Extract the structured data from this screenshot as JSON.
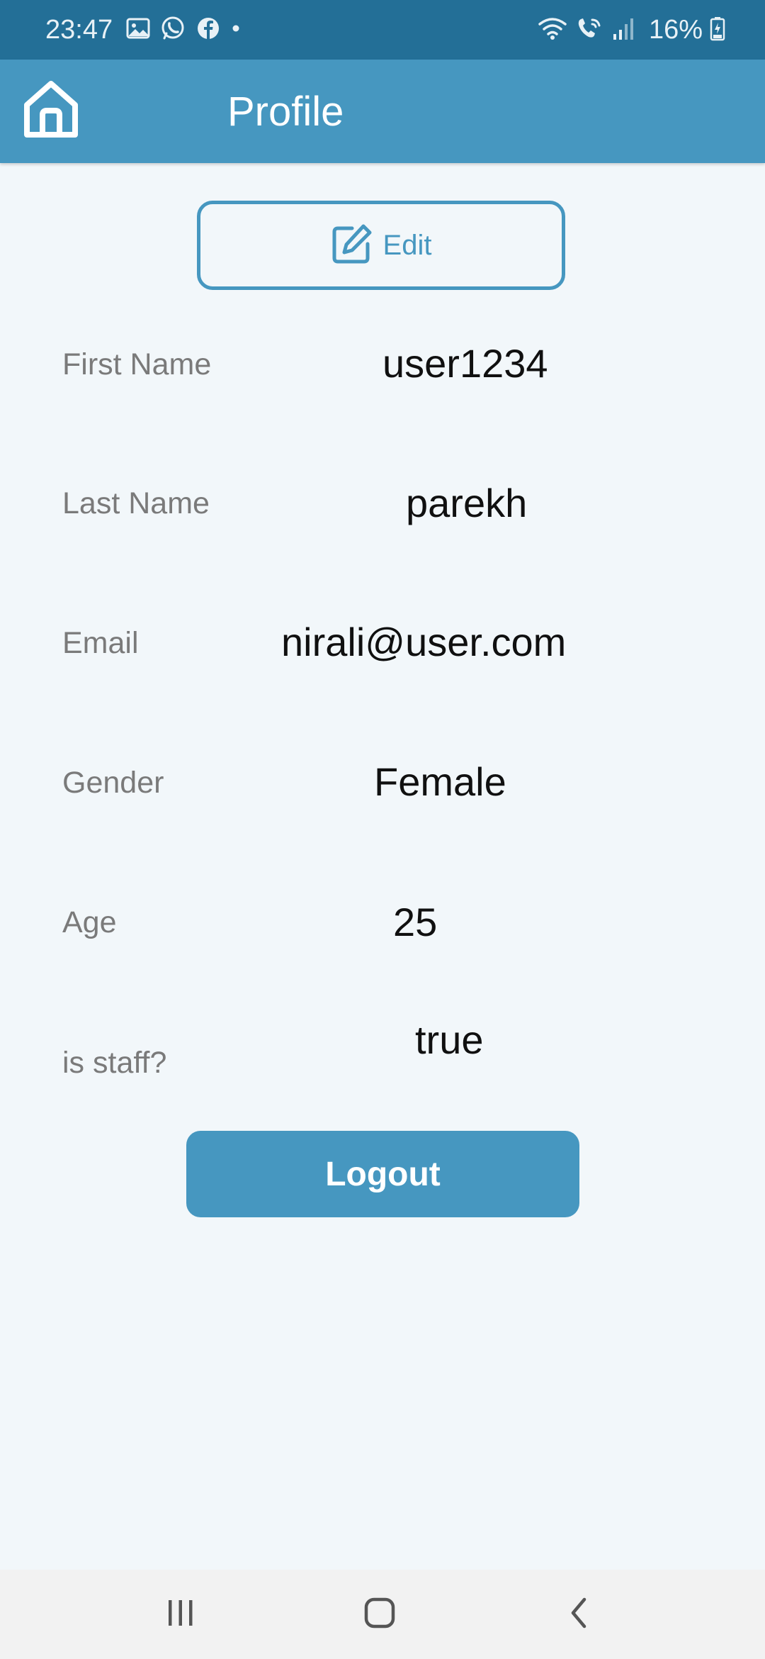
{
  "status_bar": {
    "time": "23:47",
    "left_icons": [
      "gallery-icon",
      "whatsapp-icon",
      "facebook-icon",
      "dot-icon"
    ],
    "right_icons": [
      "wifi-icon",
      "wifi-calling-icon",
      "signal-icon",
      "battery-icon"
    ],
    "battery": "16%"
  },
  "app_bar": {
    "title": "Profile",
    "home_icon": "home-icon"
  },
  "edit_button": {
    "label": "Edit",
    "icon": "edit-icon"
  },
  "profile": {
    "fields": [
      {
        "label": "First Name",
        "value": "user1234"
      },
      {
        "label": "Last Name",
        "value": "parekh"
      },
      {
        "label": "Email",
        "value": "nirali@user.com"
      },
      {
        "label": "Gender",
        "value": "Female"
      },
      {
        "label": "Age",
        "value": "25"
      },
      {
        "label": "is staff?",
        "value": "true"
      }
    ]
  },
  "logout_button": {
    "label": "Logout"
  },
  "nav_bar": {
    "icons": [
      "recents-icon",
      "home-nav-icon",
      "back-icon"
    ]
  },
  "colors": {
    "status_bar": "#236f97",
    "app_bar": "#4697c0",
    "accent": "#4697c0",
    "background": "#f2f7fa",
    "label_text": "#7a7a7a",
    "value_text": "#101010"
  }
}
